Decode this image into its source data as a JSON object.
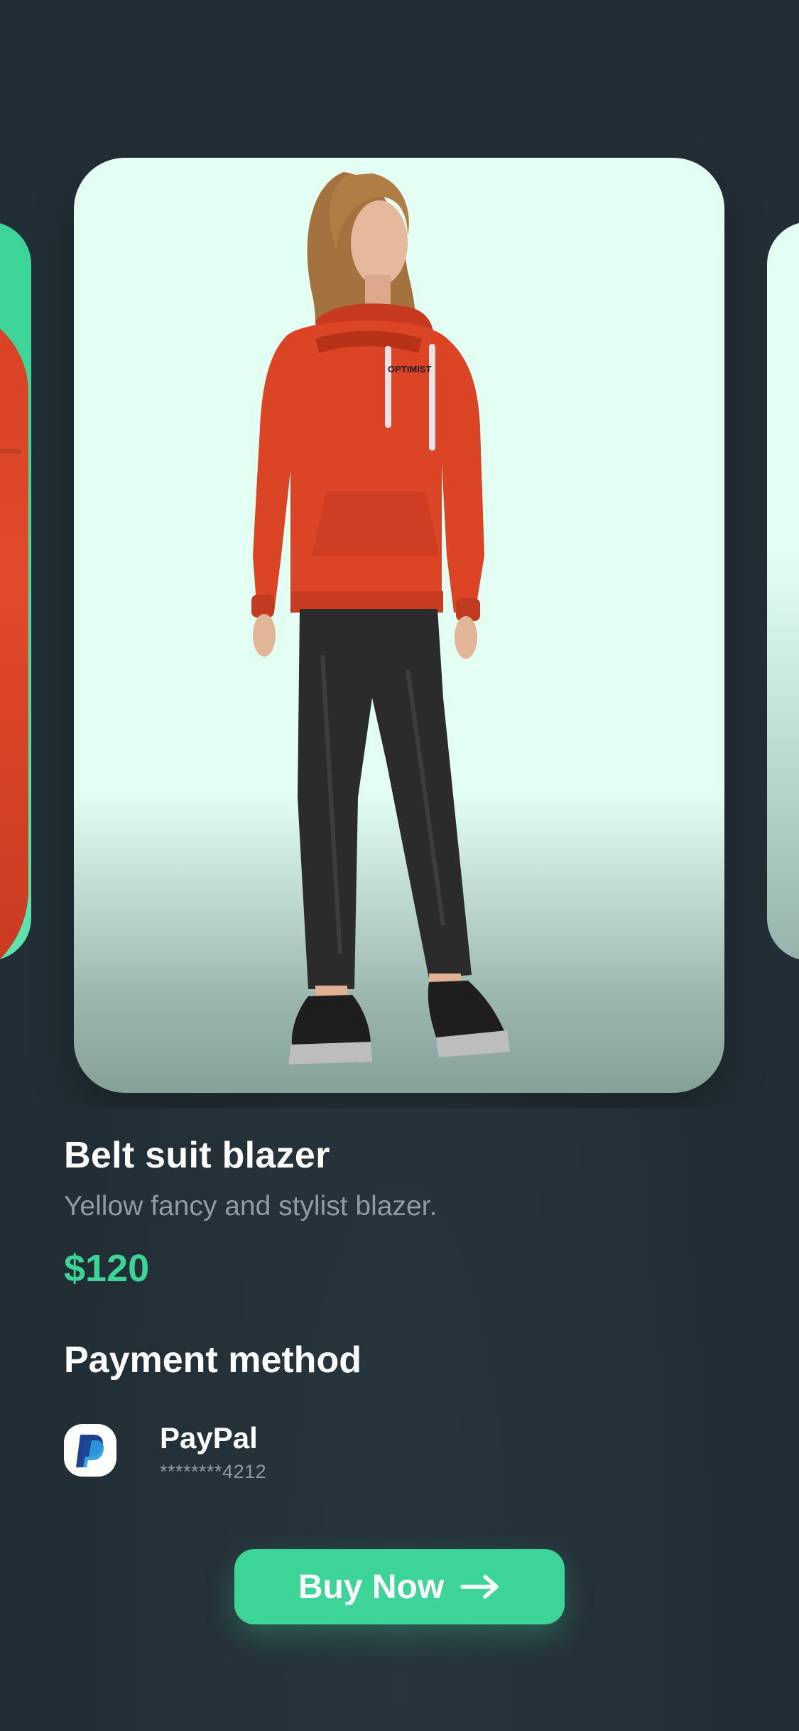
{
  "product": {
    "title": "Belt suit blazer",
    "description": "Yellow fancy and stylist blazer.",
    "price": "$120",
    "hoodie_print": "OPTIMIST"
  },
  "payment": {
    "heading": "Payment method",
    "method_name": "PayPal",
    "masked_number": "********4212",
    "icon": "paypal-icon"
  },
  "actions": {
    "buy_label": "Buy Now",
    "buy_icon": "arrow-right-icon"
  },
  "colors": {
    "background": "#222e36",
    "accent": "#3dd597",
    "card_background": "#e3fff4",
    "muted_text": "#8f9ca3"
  }
}
